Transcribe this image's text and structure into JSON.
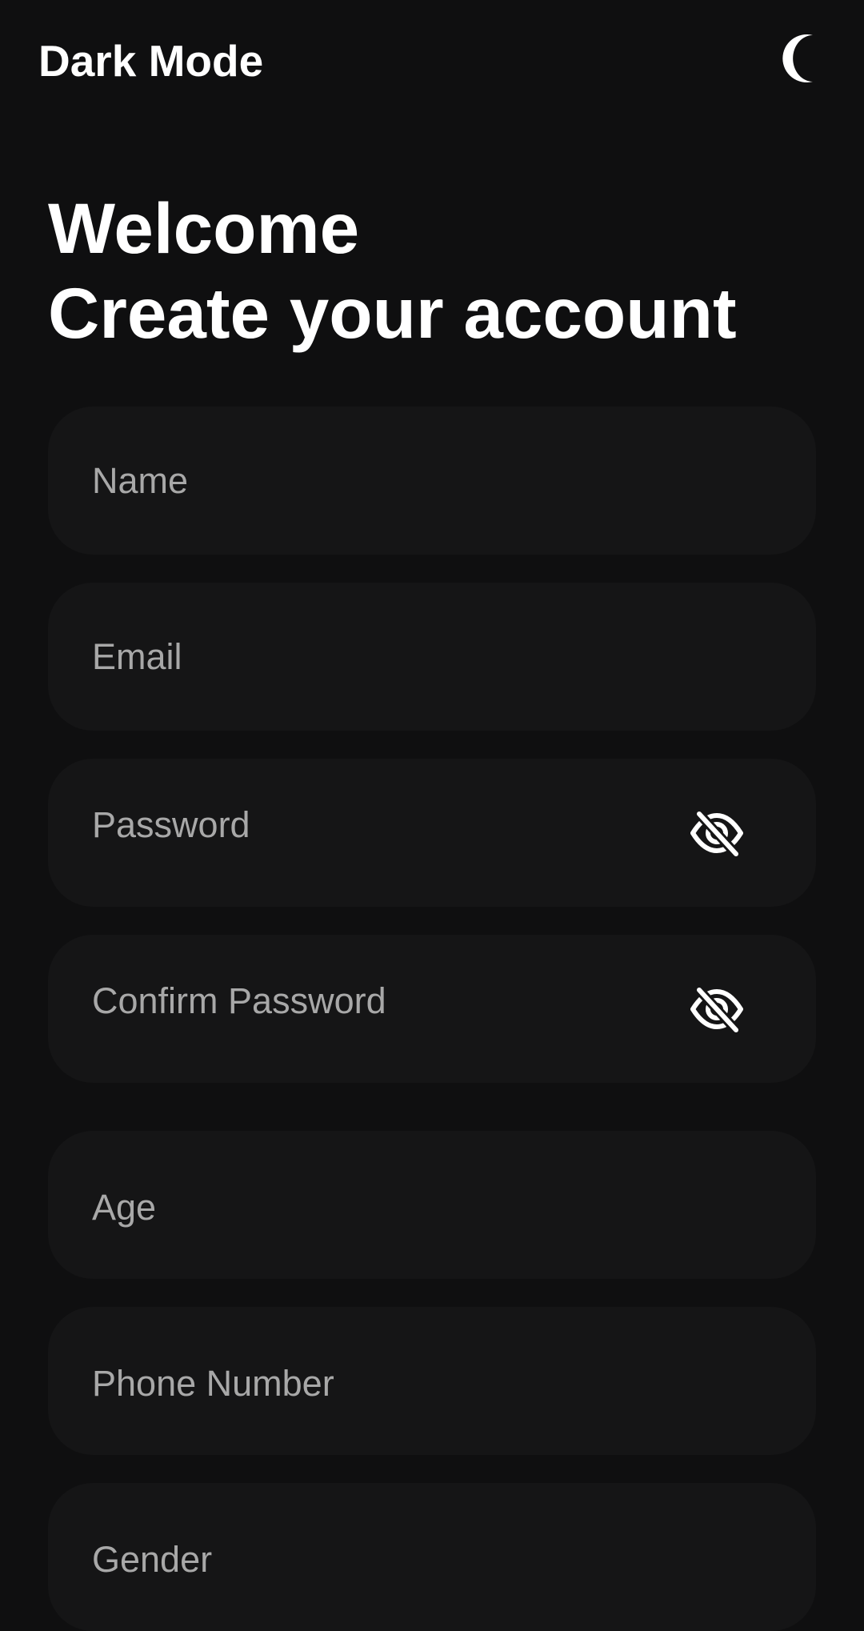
{
  "header": {
    "title": "Dark Mode",
    "theme_icon": "moon-icon"
  },
  "welcome": {
    "line1": "Welcome",
    "line2": "Create your account"
  },
  "form": {
    "name_label": "Name",
    "email_label": "Email",
    "password_label": "Password",
    "confirm_password_label": "Confirm Password",
    "age_label": "Age",
    "phone_label": "Phone Number",
    "gender_label": "Gender",
    "visibility_icon": "eye-off-icon"
  },
  "colors": {
    "background": "#0f0f10",
    "field_background": "#151516",
    "label_text": "#a8a8a8",
    "primary_text": "#ffffff"
  }
}
